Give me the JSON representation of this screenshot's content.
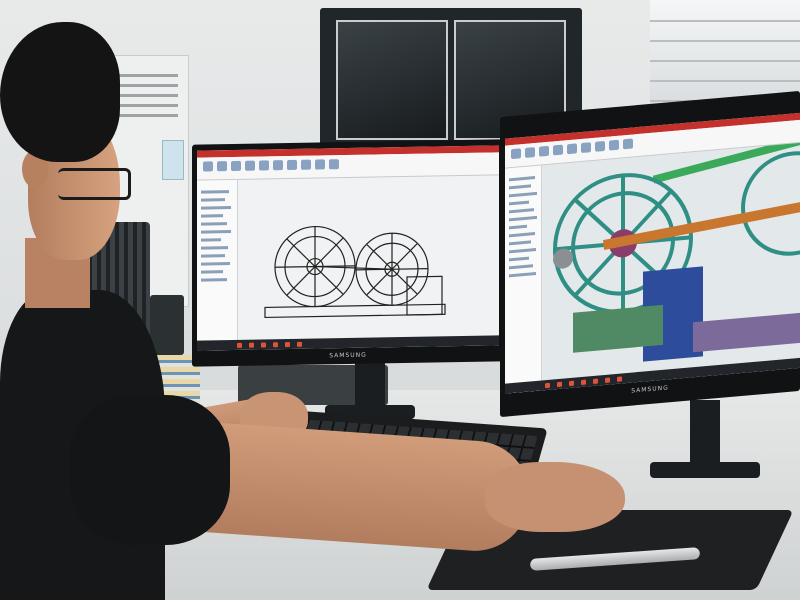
{
  "scene": {
    "description_kind": "photo",
    "monitor_brand": "SAMSUNG",
    "colors": {
      "cad_titlebar": "#c4302b",
      "wheel_teal": "#2f8f84",
      "shaft_orange": "#c9772e",
      "shaft_green": "#3aa95a",
      "machine_blue": "#2e4c9c"
    }
  },
  "icons": [
    "cad-wireframe-icon",
    "cad-shaded-icon"
  ]
}
